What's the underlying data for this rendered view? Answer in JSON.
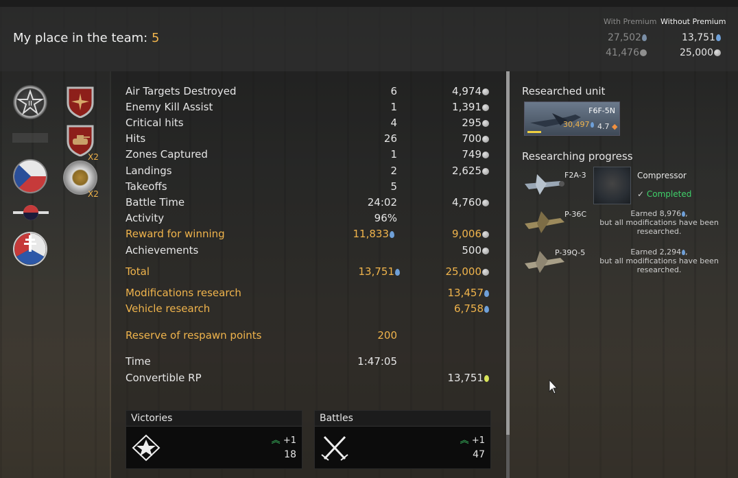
{
  "header": {
    "place_label": "My place in the team:",
    "place_value": "5",
    "with_premium_label": "With Premium",
    "without_premium_label": "Without Premium",
    "with_premium_rp": "27,502",
    "without_premium_rp": "13,751",
    "with_premium_sl": "41,476",
    "without_premium_sl": "25,000"
  },
  "stats": [
    {
      "label": "Air Targets Destroyed",
      "count": "6",
      "sl": "4,974"
    },
    {
      "label": "Enemy Kill Assist",
      "count": "1",
      "sl": "1,391"
    },
    {
      "label": "Critical hits",
      "count": "4",
      "sl": "295"
    },
    {
      "label": "Hits",
      "count": "26",
      "sl": "700"
    },
    {
      "label": "Zones Captured",
      "count": "1",
      "sl": "749"
    },
    {
      "label": "Landings",
      "count": "2",
      "sl": "2,625"
    },
    {
      "label": "Takeoffs",
      "count": "5",
      "sl": ""
    },
    {
      "label": "Battle Time",
      "count": "24:02",
      "sl": "4,760"
    },
    {
      "label": "Activity",
      "count": "96%",
      "sl": ""
    },
    {
      "label": "Reward for winning",
      "count": "11,833",
      "sl": "9,006"
    },
    {
      "label": "Achievements",
      "count": "",
      "sl": "500"
    }
  ],
  "total": {
    "label": "Total",
    "rp": "13,751",
    "sl": "25,000"
  },
  "modifications": {
    "label": "Modifications research",
    "rp": "13,457"
  },
  "vehicle": {
    "label": "Vehicle research",
    "rp": "6,758"
  },
  "reserve": {
    "label": "Reserve of respawn points",
    "value": "200"
  },
  "time": {
    "label": "Time",
    "value": "1:47:05"
  },
  "convertible": {
    "label": "Convertible RP",
    "value": "13,751"
  },
  "victories": {
    "title": "Victories",
    "delta": "+1",
    "count": "18"
  },
  "battles": {
    "title": "Battles",
    "delta": "+1",
    "count": "47"
  },
  "medals": {
    "x2a": "X2",
    "x2b": "X2"
  },
  "right": {
    "researched_unit_title": "Researched unit",
    "unit_name": "F6F-5N",
    "unit_rp": "30,497",
    "unit_br": "4.7",
    "researching_title": "Researching progress",
    "items": [
      {
        "plane": "F2A-3",
        "mod": "Compressor",
        "status": "Completed"
      },
      {
        "plane": "P-36C",
        "line1": "Earned 8,976",
        "line2": "but all modifications have been",
        "line3": "researched."
      },
      {
        "plane": "P-39Q-5",
        "line1": "Earned 2,294",
        "line2": "but all modifications have been",
        "line3": "researched."
      }
    ]
  },
  "colors": {
    "accent": "#f0b44c",
    "rp_blue": "#6fa0d8",
    "up_green": "#3fd16a"
  }
}
